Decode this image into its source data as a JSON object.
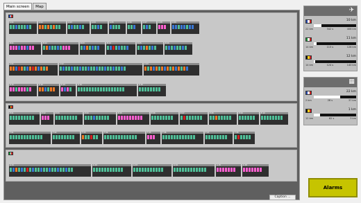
{
  "tabs": [
    {
      "label": "Main screen"
    },
    {
      "label": "Map"
    }
  ],
  "caption": "Caption ...",
  "alarms_label": "Alarms",
  "colors": {
    "teal": "#4fbf98",
    "pink": "#ff5fd0",
    "blue": "#3a78d4",
    "orange": "#f07a26",
    "gray": "#8a8a8a",
    "red": "#d32020"
  },
  "sidebar": {
    "top": {
      "icon": "airplane-icon",
      "entries": [
        {
          "flag": [
            "#2a4bb0",
            "#ffffff",
            "#d32020"
          ],
          "value": "10 km",
          "level": 0.18,
          "sub": [
            "22 km",
            "342 s",
            "408 km"
          ]
        },
        {
          "flag": [
            "#1c9a3a",
            "#ffffff",
            "#d32020"
          ],
          "value": "11 km",
          "level": 0.06,
          "sub": [
            "14 km",
            "113 s",
            "128 km"
          ]
        },
        {
          "flag": [
            "#111111",
            "#f2d21a",
            "#d32020"
          ],
          "value": "12 km",
          "level": 0.04,
          "sub": [
            "14 km",
            "124 s",
            "140 km"
          ]
        }
      ]
    },
    "bottom": {
      "icon": "grid-icon",
      "entries": [
        {
          "flag": [
            "#2a4bb0",
            "#ffffff",
            "#d32020"
          ],
          "value": "22 km",
          "level": 0.62,
          "sub": [
            "2 km",
            "28 s",
            "37 km"
          ]
        },
        {
          "flag": [
            "#111111",
            "#f2d21a",
            "#d32020"
          ],
          "value": "1 km",
          "level": 0.15,
          "sub": [
            "12 km",
            "62 s",
            "3 km"
          ]
        }
      ]
    }
  }
}
